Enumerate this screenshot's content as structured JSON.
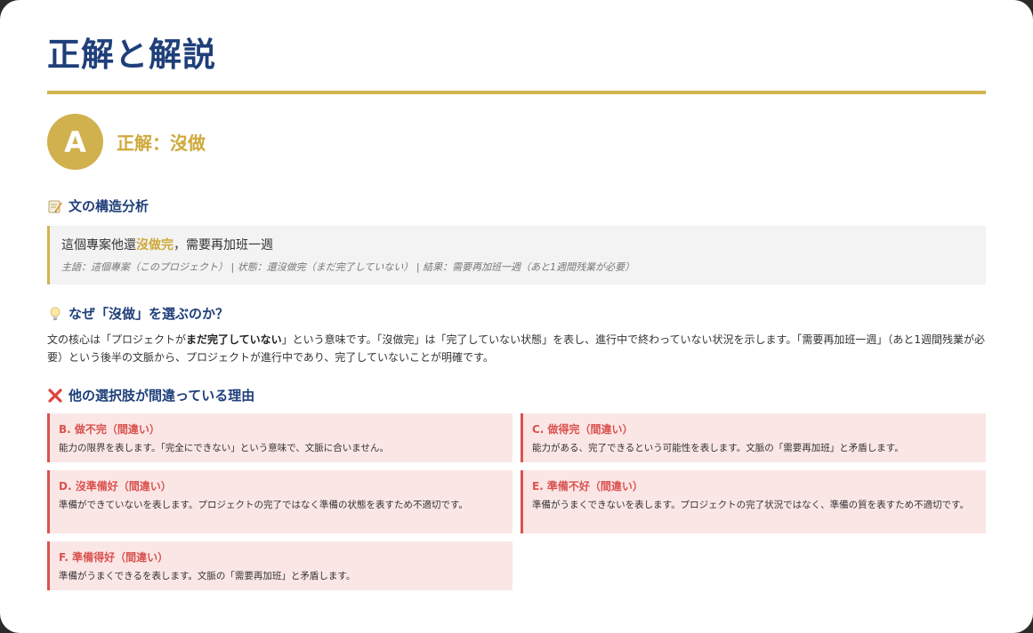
{
  "page": {
    "title": "正解と解説"
  },
  "answer": {
    "badge": "A",
    "label": "正解：沒做"
  },
  "structure": {
    "heading": "文の構造分析",
    "icon": "memo-icon",
    "sentence_before": "這個專案他還",
    "sentence_highlight": "沒做完",
    "sentence_after": "，需要再加班一週",
    "note": "主語：這個專案（このプロジェクト） | 状態：還沒做完（まだ完了していない） | 結果：需要再加班一週（あと1週間残業が必要）",
    "accent_color": "#d1b44e"
  },
  "why": {
    "heading": "なぜ「沒做」を選ぶのか？",
    "icon": "lightbulb-icon",
    "text_1": "文の核心は「プロジェクトが",
    "text_bold": "まだ完了していない",
    "text_2": "」という意味です。「沒做完」は「完了していない状態」を表し、進行中で終わっていない状況を示します。「需要再加班一週」（あと1週間残業が必要）という後半の文脈から、プロジェクトが進行中であり、完了していないことが明確です。"
  },
  "wrong": {
    "heading": "他の選択肢が間違っている理由",
    "icon": "cross-icon",
    "accent_color": "#d9534f",
    "options": [
      {
        "title": "B. 做不完（間違い）",
        "desc": "能力の限界を表します。「完全にできない」という意味で、文脈に合いません。"
      },
      {
        "title": "C. 做得完（間違い）",
        "desc": "能力がある、完了できるという可能性を表します。文脈の「需要再加班」と矛盾します。"
      },
      {
        "title": "D. 沒準備好（間違い）",
        "desc": "準備ができていないを表します。プロジェクトの完了ではなく準備の状態を表すため不適切です。"
      },
      {
        "title": "E. 準備不好（間違い）",
        "desc": "準備がうまくできないを表します。プロジェクトの完了状況ではなく、準備の質を表すため不適切です。"
      },
      {
        "title": "F. 準備得好（間違い）",
        "desc": "準備がうまくできるを表します。文脈の「需要再加班」と矛盾します。"
      }
    ]
  }
}
